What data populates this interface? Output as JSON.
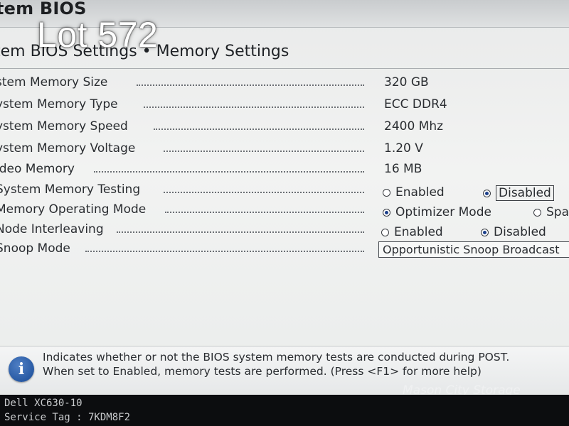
{
  "overlay": {
    "lot_label": "Lot 572"
  },
  "header": {
    "title": "tem BIOS"
  },
  "breadcrumb": {
    "text": "tem BIOS Settings • Memory Settings"
  },
  "settings": {
    "rows": [
      {
        "label": "stem Memory Size",
        "value": "320 GB"
      },
      {
        "label": "ystem Memory Type",
        "value": "ECC DDR4"
      },
      {
        "label": "ystem Memory Speed",
        "value": "2400 Mhz"
      },
      {
        "label": "ystem Memory Voltage",
        "value": "1.20 V"
      },
      {
        "label": "ideo Memory",
        "value": "16 MB"
      }
    ],
    "memory_testing": {
      "label": "System Memory Testing",
      "options": [
        "Enabled",
        "Disabled"
      ],
      "selected": "Disabled"
    },
    "operating_mode": {
      "label": "Memory Operating Mode",
      "options": [
        "Optimizer Mode",
        "Spa"
      ],
      "selected": "Optimizer Mode"
    },
    "node_interleaving": {
      "label": "Node Interleaving",
      "options": [
        "Enabled",
        "Disabled"
      ],
      "selected": "Disabled"
    },
    "snoop_mode": {
      "label": "Snoop Mode",
      "value": "Opportunistic Snoop Broadcast"
    }
  },
  "help": {
    "icon": "info-icon",
    "line1": "Indicates whether or not the BIOS system memory tests are conducted during POST.",
    "line2": "When set to Enabled, memory tests are performed. (Press <F1> for more help)"
  },
  "footer": {
    "model": "Dell XC630-10",
    "service_tag": "Service Tag : 7KDM8F2"
  },
  "watermark": {
    "text": "Mason City Storage"
  },
  "colors": {
    "accent": "#1b3f8a",
    "info_icon": "#184a96",
    "background": "#eceeed"
  }
}
